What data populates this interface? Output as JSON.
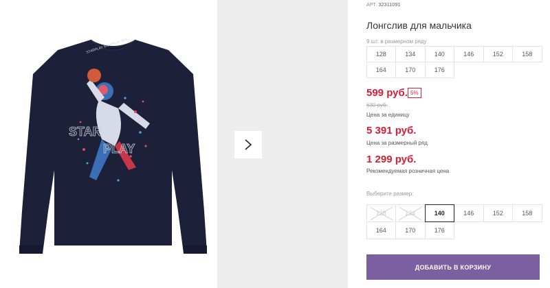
{
  "product": {
    "article_label": "АРТ.",
    "article_value": "32311091",
    "title": "Лонгслив для мальчика",
    "pack_note": "9 шт. в размерном ряду",
    "print_text": "STAR PLAY",
    "collar_text": "STARPLAY STARPLAY STA"
  },
  "pack_sizes": [
    "128",
    "134",
    "140",
    "146",
    "152",
    "158",
    "164",
    "170",
    "176"
  ],
  "pricing": {
    "unit_price": "599 руб.",
    "discount": "5%",
    "old_price": "630 руб.",
    "unit_label": "Цена за единицу",
    "pack_price": "5 391 руб.",
    "pack_label": "Цена за размерный ряд",
    "retail_price": "1 299 руб.",
    "retail_label": "Рекомендуемая розничная цена"
  },
  "size_picker": {
    "label": "Выберите размер:",
    "sizes": [
      "128",
      "134",
      "140",
      "146",
      "152",
      "158",
      "164",
      "170",
      "176"
    ],
    "unavailable": [
      "128",
      "134"
    ],
    "selected": "140"
  },
  "cart_button": "ДОБАВИТЬ В КОРЗИНУ",
  "colors": {
    "accent": "#7b5fa0",
    "price": "#d41e36",
    "shirt": "#1c2038"
  }
}
